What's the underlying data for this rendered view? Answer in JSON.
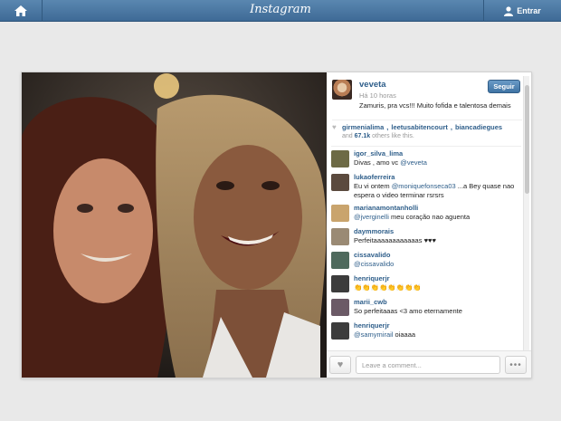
{
  "header": {
    "logo": "Instagram",
    "login_label": "Entrar",
    "home_icon": "home-icon",
    "user_icon": "user-icon"
  },
  "post": {
    "username": "veveta",
    "time": "Há 10 horas",
    "caption": "Zamuris, pra vcs!!! Muito fofida e talentosa demais",
    "follow_label": "Seguir",
    "likers": [
      "girmenialima",
      "leetusabitencourt",
      "biancadiegues"
    ],
    "likes_count": "67.1k",
    "likes_suffix": "others like this."
  },
  "comments": [
    {
      "user": "igor_silva_lima",
      "text": "Divas , amo vc ",
      "mention": "@veveta",
      "text_after": ""
    },
    {
      "user": "lukaoferreira",
      "text": "Eu vi ontem ",
      "mention": "@moniquefonseca03",
      "text_after": " ...a Bey quase nao espera o video terminar rsrsrs"
    },
    {
      "user": "marianamontanholli",
      "text": "",
      "mention": "@jverginelli",
      "text_after": " meu coração nao aguenta"
    },
    {
      "user": "daymmorais",
      "text": "Perfeitaaaaaaaaaaaas ♥♥♥",
      "mention": "",
      "text_after": ""
    },
    {
      "user": "cissavalido",
      "text": "",
      "mention": "@cissavalido",
      "text_after": ""
    },
    {
      "user": "henriquerjr",
      "text": "👏👏👏👏👏👏👏👏",
      "mention": "",
      "text_after": ""
    },
    {
      "user": "marii_cwb",
      "text": "So perfeitaaas <3 amo eternamente",
      "mention": "",
      "text_after": ""
    },
    {
      "user": "henriquerjr",
      "text": "",
      "mention": "@samymirail",
      "text_after": " oiaaaa"
    }
  ],
  "footer": {
    "comment_placeholder": "Leave a comment...",
    "more_label": "•••",
    "heart_icon": "heart-icon"
  },
  "colors": {
    "topbar": "#4a77a3",
    "link": "#2e5e8a",
    "follow": "#4d80b0"
  }
}
